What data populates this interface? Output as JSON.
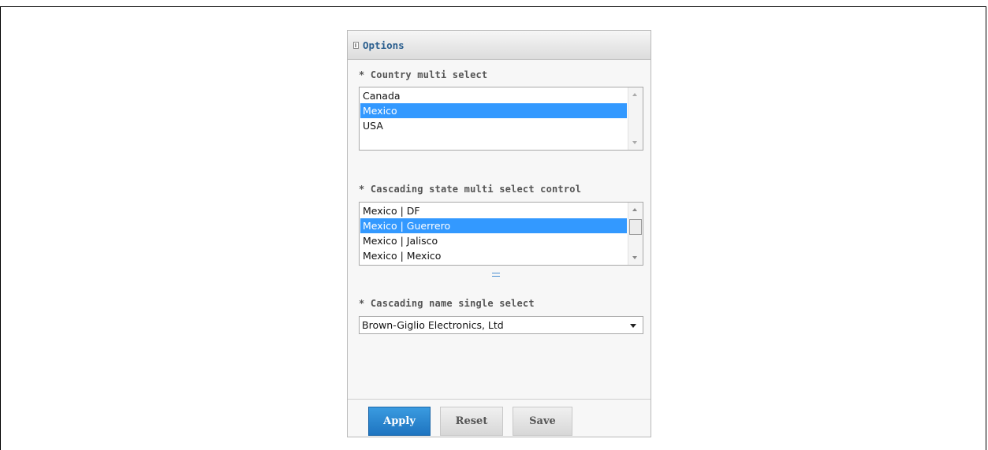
{
  "panel": {
    "title": "Options"
  },
  "country_select": {
    "label": "* Country multi select",
    "options": [
      {
        "label": "Canada",
        "selected": false
      },
      {
        "label": "Mexico",
        "selected": true
      },
      {
        "label": "USA",
        "selected": false
      }
    ]
  },
  "state_select": {
    "label": "* Cascading state multi select control",
    "options": [
      {
        "label": "Mexico | DF",
        "selected": false
      },
      {
        "label": "Mexico | Guerrero",
        "selected": true
      },
      {
        "label": "Mexico | Jalisco",
        "selected": false
      },
      {
        "label": "Mexico | Mexico",
        "selected": false
      }
    ]
  },
  "name_select": {
    "label": "* Cascading name single select",
    "value": "Brown-Giglio Electronics, Ltd"
  },
  "buttons": {
    "apply": "Apply",
    "reset": "Reset",
    "save": "Save"
  },
  "colors": {
    "selection": "#3399ff",
    "apply_button": "#2a86d0",
    "title": "#2a5e8e"
  }
}
